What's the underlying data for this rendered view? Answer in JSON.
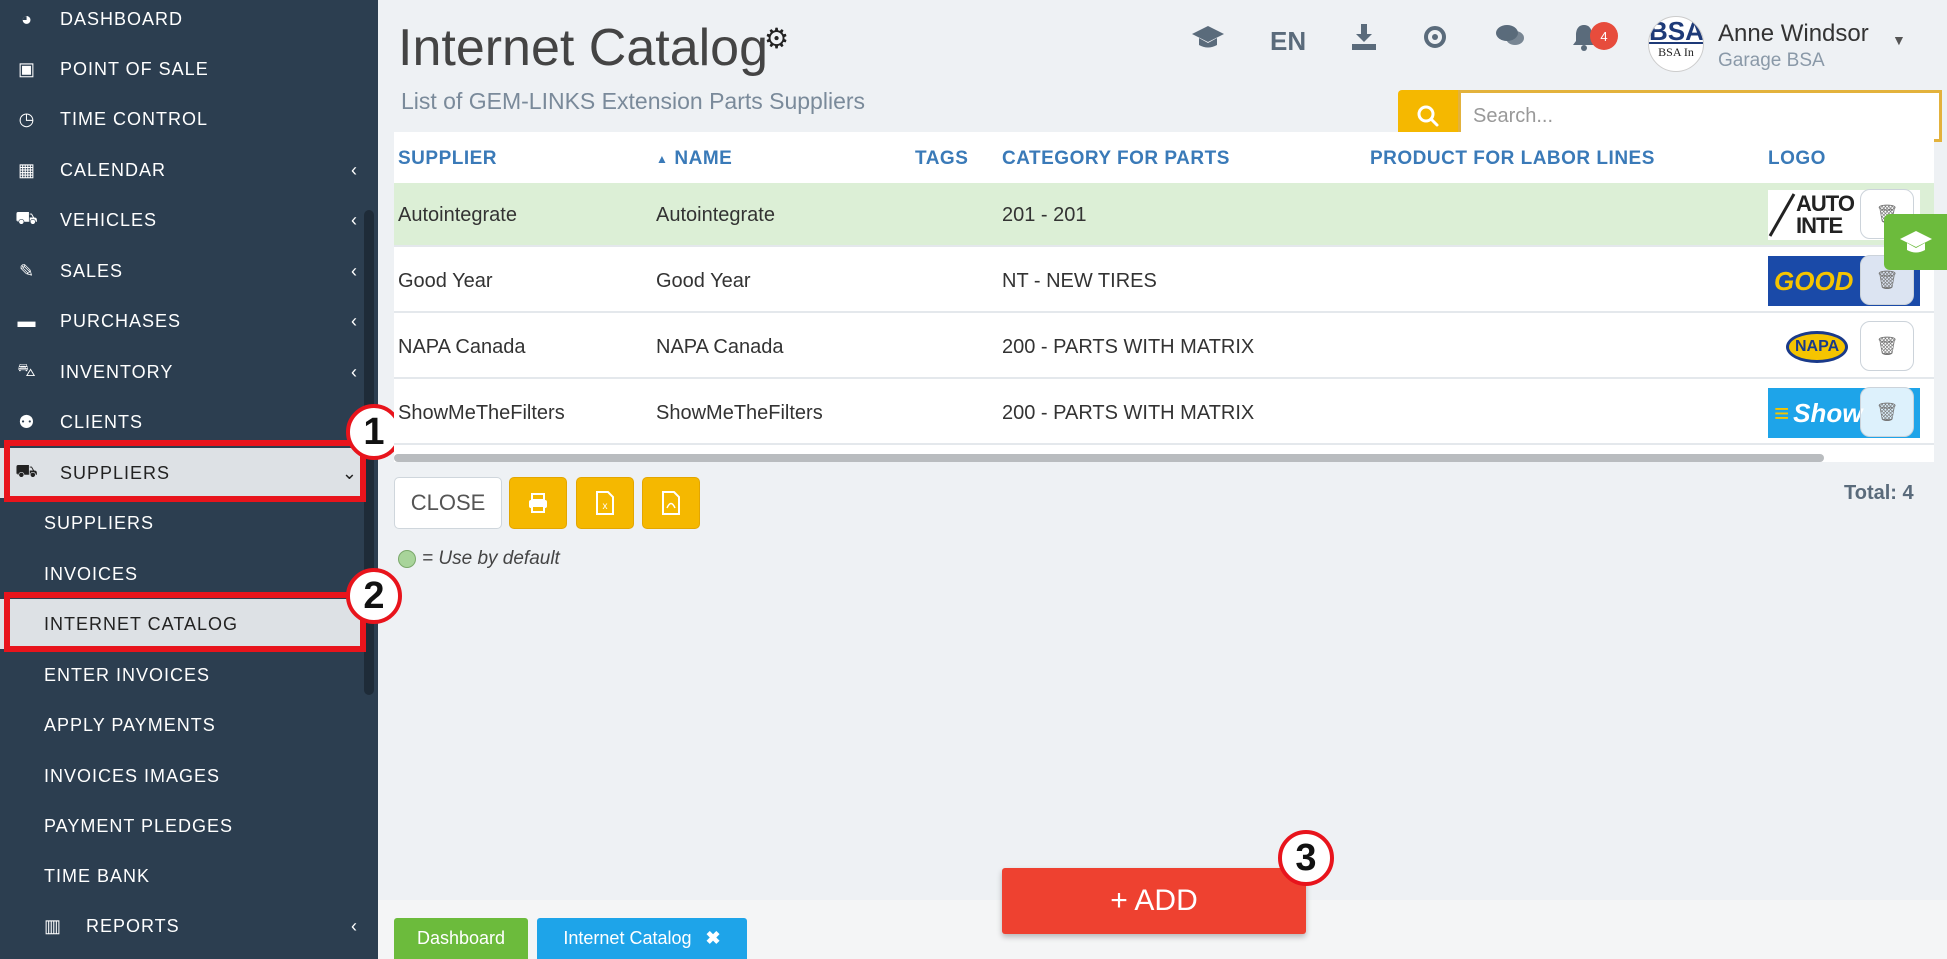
{
  "sidebar": {
    "items": [
      {
        "label": "DASHBOARD",
        "icon": "tachometer-icon",
        "glyph": "◕"
      },
      {
        "label": "POINT OF SALE",
        "icon": "money-icon",
        "glyph": "▣"
      },
      {
        "label": "TIME CONTROL",
        "icon": "clock-icon",
        "glyph": "◷"
      },
      {
        "label": "CALENDAR",
        "icon": "calendar-icon",
        "glyph": "▦"
      },
      {
        "label": "VEHICLES",
        "icon": "car-icon",
        "glyph": "⛟"
      },
      {
        "label": "SALES",
        "icon": "edit-icon",
        "glyph": "✎"
      },
      {
        "label": "PURCHASES",
        "icon": "credit-card-icon",
        "glyph": "▬"
      },
      {
        "label": "INVENTORY",
        "icon": "cart-icon",
        "glyph": "⛍"
      },
      {
        "label": "CLIENTS",
        "icon": "users-icon",
        "glyph": "⚉"
      },
      {
        "label": "SUPPLIERS",
        "icon": "truck-icon",
        "glyph": "⛟"
      }
    ],
    "sub_items": [
      "SUPPLIERS",
      "INVOICES",
      "INTERNET CATALOG",
      "ENTER INVOICES",
      "APPLY PAYMENTS",
      "INVOICES IMAGES",
      "PAYMENT PLEDGES",
      "TIME BANK"
    ],
    "reports": {
      "label": "REPORTS",
      "icon": "bar-chart-icon",
      "glyph": "▥"
    }
  },
  "annotations": {
    "step1": "1",
    "step2": "2",
    "step3": "3",
    "color": "#e8141c"
  },
  "header": {
    "title": "Internet Catalog",
    "subtitle": "List of GEM-LINKS Extension Parts Suppliers",
    "lang": "EN",
    "notifications": "4",
    "user_name": "Anne Windsor",
    "user_org": "Garage BSA",
    "avatar_text": "BSA",
    "avatar_sub": "BSA In"
  },
  "search": {
    "placeholder": "Search..."
  },
  "table": {
    "headers": [
      "SUPPLIER",
      "NAME",
      "TAGS",
      "CATEGORY FOR PARTS",
      "PRODUCT FOR LABOR LINES",
      "LOGO"
    ],
    "sort_indicator": "▲",
    "rows": [
      {
        "supplier": "Autointegrate",
        "name": "Autointegrate",
        "tags": "",
        "category": "201 - 201",
        "product": "",
        "logo_text": "AUTO INTE",
        "default": true
      },
      {
        "supplier": "Good Year",
        "name": "Good Year",
        "tags": "",
        "category": "NT - NEW TIRES",
        "product": "",
        "logo_text": "GOOD",
        "default": false
      },
      {
        "supplier": "NAPA Canada",
        "name": "NAPA Canada",
        "tags": "",
        "category": "200 - PARTS WITH MATRIX",
        "product": "",
        "logo_text": "NAPA",
        "default": false
      },
      {
        "supplier": "ShowMeTheFilters",
        "name": "ShowMeTheFilters",
        "tags": "",
        "category": "200 - PARTS WITH MATRIX",
        "product": "",
        "logo_text": "Show",
        "default": false
      }
    ]
  },
  "actions": {
    "close": "CLOSE",
    "total": "Total: 4",
    "legend": "= Use by default",
    "add": "+ ADD"
  },
  "bottom_tabs": [
    "Dashboard",
    "Internet Catalog"
  ],
  "colors": {
    "sidebar": "#2c3e50",
    "accent_yellow": "#f5b800",
    "add_red": "#ee4130",
    "link_blue": "#3a7ab8",
    "default_green": "#dcefd6"
  }
}
